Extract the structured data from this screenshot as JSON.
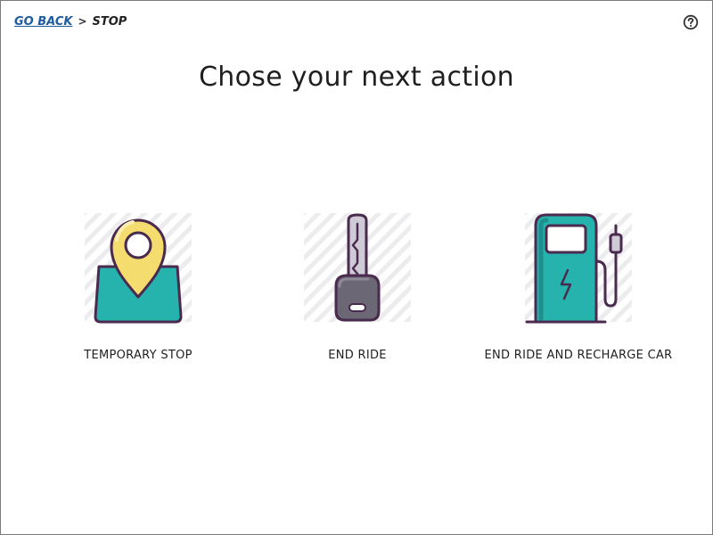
{
  "breadcrumb": {
    "back_label": "GO BACK",
    "separator": ">",
    "current_label": "STOP"
  },
  "page": {
    "title": "Chose your next action"
  },
  "options": [
    {
      "label": "TEMPORARY STOP",
      "icon": "map-pin-icon"
    },
    {
      "label": "END RIDE",
      "icon": "car-key-icon"
    },
    {
      "label": "END RIDE AND RECHARGE CAR",
      "icon": "charging-station-icon"
    }
  ],
  "icons": {
    "help": "help-circle-icon"
  },
  "colors": {
    "link": "#1f5c9e",
    "teal": "#26b3ad",
    "yellow": "#f5dc6e",
    "outline": "#4a2a4e",
    "key_gray": "#6b6774",
    "key_blade": "#cfcbd6"
  }
}
